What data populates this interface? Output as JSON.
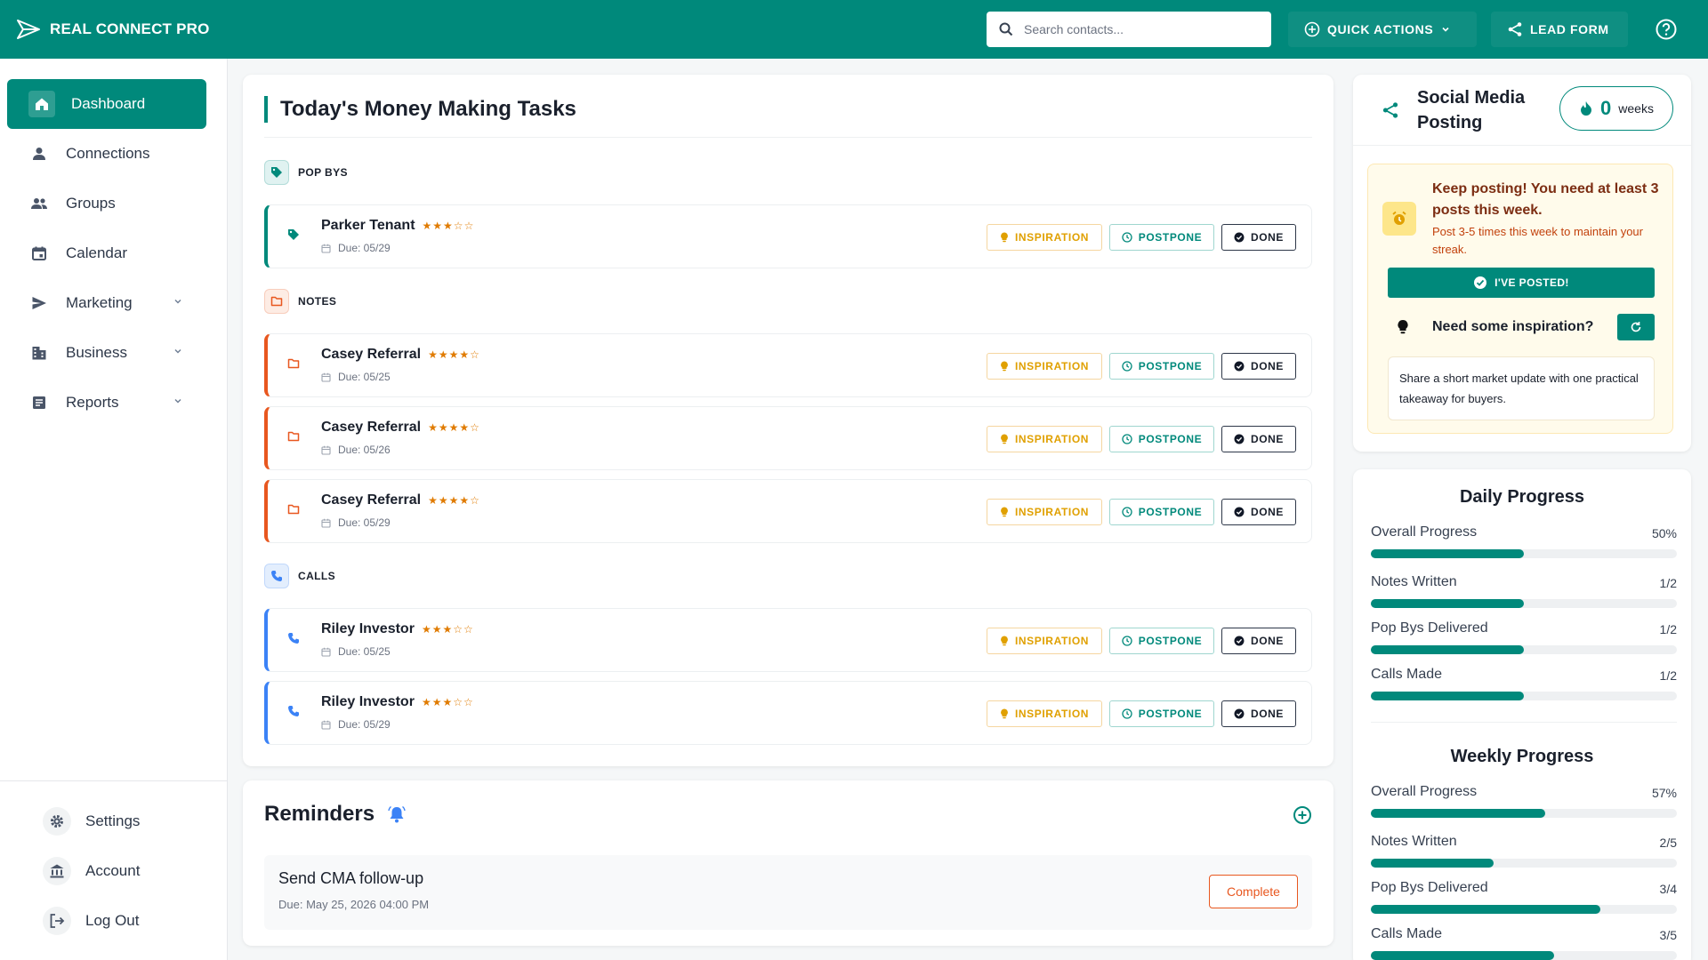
{
  "app": {
    "name": "REAL CONNECT PRO"
  },
  "header": {
    "search_placeholder": "Search contacts...",
    "quick_actions_label": "QUICK ACTIONS",
    "lead_form_label": "LEAD FORM"
  },
  "colors": {
    "brand": "#00897b",
    "pop_bys": "#00897b",
    "notes": "#e8571f",
    "calls": "#3b82f6",
    "warning": "#e0a000"
  },
  "sidebar": {
    "items": [
      {
        "label": "Dashboard",
        "icon": "home-icon",
        "active": true,
        "has_chevron": false
      },
      {
        "label": "Connections",
        "icon": "person-icon",
        "active": false,
        "has_chevron": false
      },
      {
        "label": "Groups",
        "icon": "group-icon",
        "active": false,
        "has_chevron": false
      },
      {
        "label": "Calendar",
        "icon": "calendar-icon",
        "active": false,
        "has_chevron": false
      },
      {
        "label": "Marketing",
        "icon": "send-icon",
        "active": false,
        "has_chevron": true
      },
      {
        "label": "Business",
        "icon": "building-icon",
        "active": false,
        "has_chevron": true
      },
      {
        "label": "Reports",
        "icon": "report-icon",
        "active": false,
        "has_chevron": true
      }
    ],
    "bottom": [
      {
        "label": "Settings",
        "icon": "gear-icon"
      },
      {
        "label": "Account",
        "icon": "bank-icon"
      },
      {
        "label": "Log Out",
        "icon": "logout-icon"
      }
    ]
  },
  "tasks": {
    "title": "Today's Money Making Tasks",
    "button_labels": {
      "inspiration": "INSPIRATION",
      "postpone": "POSTPONE",
      "done": "DONE"
    },
    "sections": [
      {
        "label": "POP BYS",
        "icon": "tag-icon",
        "color_key": "pop_bys",
        "items": [
          {
            "name": "Parker Tenant",
            "stars": "★★★☆☆",
            "due": "Due: 05/29"
          }
        ]
      },
      {
        "label": "NOTES",
        "icon": "folder-icon",
        "color_key": "notes",
        "items": [
          {
            "name": "Casey Referral",
            "stars": "★★★★☆",
            "due": "Due: 05/25"
          },
          {
            "name": "Casey Referral",
            "stars": "★★★★☆",
            "due": "Due: 05/26"
          },
          {
            "name": "Casey Referral",
            "stars": "★★★★☆",
            "due": "Due: 05/29"
          }
        ]
      },
      {
        "label": "CALLS",
        "icon": "phone-icon",
        "color_key": "calls",
        "items": [
          {
            "name": "Riley Investor",
            "stars": "★★★☆☆",
            "due": "Due: 05/25"
          },
          {
            "name": "Riley Investor",
            "stars": "★★★☆☆",
            "due": "Due: 05/29"
          }
        ]
      }
    ]
  },
  "reminders": {
    "title": "Reminders",
    "items": [
      {
        "name": "Send CMA follow-up",
        "due": "Due: May 25, 2026 04:00 PM",
        "action": "Complete"
      }
    ]
  },
  "social": {
    "title": "Social Media Posting",
    "streak_count": "0",
    "streak_unit": "weeks",
    "warning_head": "Keep posting! You need at least 3 posts this week.",
    "warning_sub": "Post 3-5 times this week to maintain your streak.",
    "posted_button": "I'VE POSTED!",
    "inspiration_label": "Need some inspiration?",
    "inspiration_text": "Share a short market update with one practical takeaway for buyers."
  },
  "progress": {
    "daily": {
      "title": "Daily Progress",
      "rows": [
        {
          "label": "Overall Progress",
          "value": "50%",
          "fraction": 0.5
        },
        {
          "label": "Notes Written",
          "value": "1/2",
          "fraction": 0.5
        },
        {
          "label": "Pop Bys Delivered",
          "value": "1/2",
          "fraction": 0.5
        },
        {
          "label": "Calls Made",
          "value": "1/2",
          "fraction": 0.5
        }
      ]
    },
    "weekly": {
      "title": "Weekly Progress",
      "rows": [
        {
          "label": "Overall Progress",
          "value": "57%",
          "fraction": 0.57
        },
        {
          "label": "Notes Written",
          "value": "2/5",
          "fraction": 0.4
        },
        {
          "label": "Pop Bys Delivered",
          "value": "3/4",
          "fraction": 0.75
        },
        {
          "label": "Calls Made",
          "value": "3/5",
          "fraction": 0.6
        }
      ]
    }
  }
}
